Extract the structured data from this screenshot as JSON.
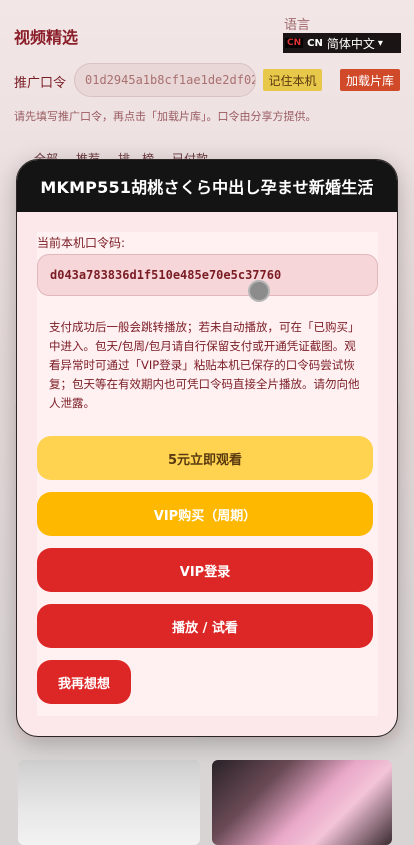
{
  "page": {
    "title": "视频精选",
    "language_label": "语言",
    "language": {
      "flag": "CN",
      "code": "CN",
      "selected": "简体中文"
    },
    "promo_label": "推广口令",
    "promo_code": "01d2945a1b8cf1ae1de2df02",
    "remember_button": "记住本机",
    "load_button": "加载片库",
    "hint": "请先填写推广口令，再点击「加载片库」。口令由分享方提供。",
    "tabs": [
      "全部",
      "推荐",
      "排…榜",
      "已付款"
    ]
  },
  "modal": {
    "title": "MKMP551胡桃さくら中出し孕ませ新婚生活",
    "code_label": "当前本机口令码:",
    "code_value": "d043a783836d1f510e485e70e5c37760",
    "info": "支付成功后一般会跳转播放；若未自动播放，可在「已购买」中进入。包天/包周/包月请自行保留支付或开通凭证截图。观看异常时可通过「VIP登录」粘贴本机已保存的口令码尝试恢复；包天等在有效期内也可凭口令码直接全片播放。请勿向他人泄露。",
    "buttons": {
      "watch": "5元立即观看",
      "vip_buy": "VIP购买（周期）",
      "vip_login": "VIP登录",
      "play": "播放 / 试看",
      "rethink": "我再想想"
    }
  },
  "colors": {
    "accent_red": "#dd2727",
    "accent_yellow": "#ffd34f",
    "accent_amber": "#ffb800",
    "header_bg": "#141414"
  }
}
